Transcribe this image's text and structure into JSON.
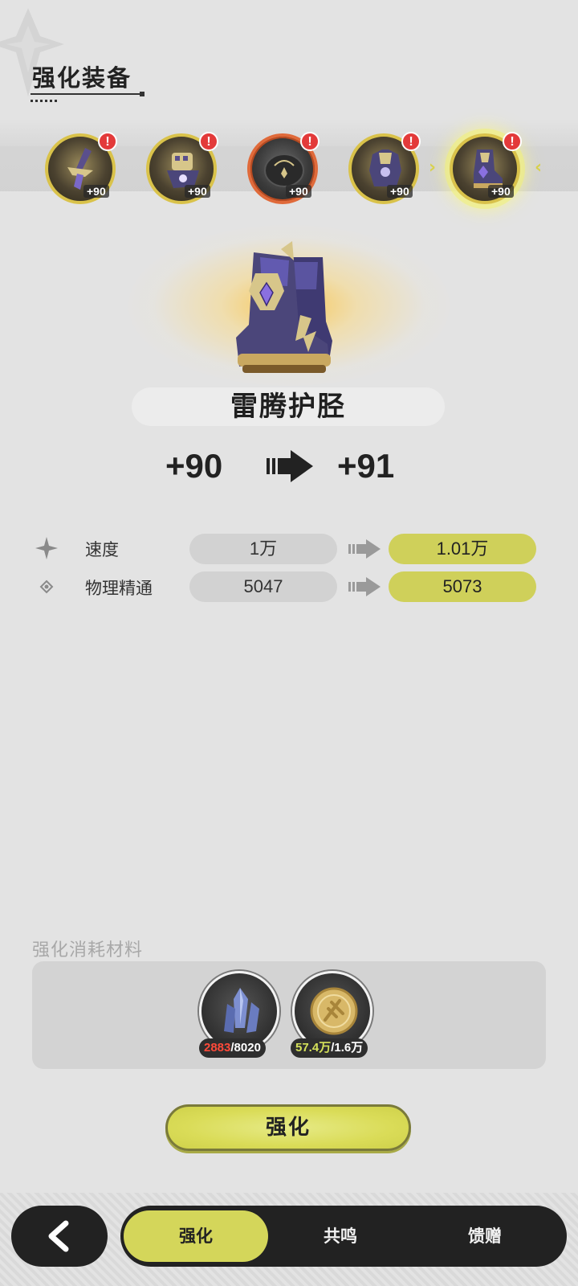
{
  "header": {
    "title": "强化装备"
  },
  "equipment_slots": [
    {
      "name": "weapon",
      "level": "+90",
      "alert": "!",
      "icon": "blade-icon"
    },
    {
      "name": "gloves",
      "level": "+90",
      "alert": "!",
      "icon": "gauntlet-icon"
    },
    {
      "name": "ring",
      "level": "+90",
      "alert": "!",
      "icon": "ring-icon"
    },
    {
      "name": "armor",
      "level": "+90",
      "alert": "!",
      "icon": "armor-icon"
    },
    {
      "name": "boots",
      "level": "+90",
      "alert": "!",
      "icon": "boots-icon",
      "selected": true
    }
  ],
  "item": {
    "name": "雷腾护胫",
    "level_from": "+90",
    "level_to": "+91"
  },
  "stats": [
    {
      "name": "速度",
      "old": "1万",
      "new": "1.01万",
      "icon": "four-point-star-icon"
    },
    {
      "name": "物理精通",
      "old": "5047",
      "new": "5073",
      "icon": "diamond-dot-icon"
    }
  ],
  "materials": {
    "label": "强化消耗材料",
    "items": [
      {
        "name": "crystal-ore",
        "have": "2883",
        "need": "/8020",
        "icon": "crystal-icon"
      },
      {
        "name": "gold-coin",
        "have": "57.4万",
        "need": "/1.6万",
        "icon": "coin-icon"
      }
    ]
  },
  "enhance_button": {
    "label": "强化"
  },
  "nav": {
    "tabs": [
      {
        "label": "强化",
        "active": true
      },
      {
        "label": "共鸣"
      },
      {
        "label": "馈赠"
      }
    ]
  },
  "colors": {
    "accent": "#d4d65a",
    "alert": "#e33a3a",
    "dark": "#222222",
    "insufficient": "#ff4a3a"
  }
}
